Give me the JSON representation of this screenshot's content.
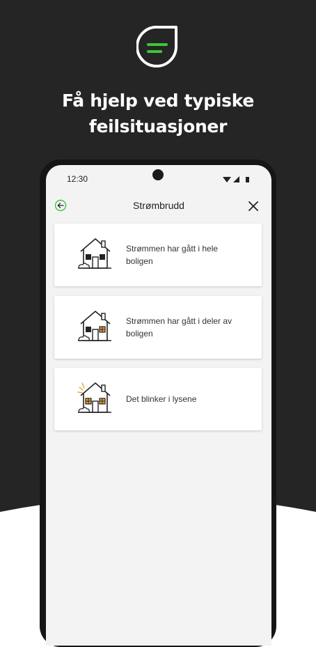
{
  "headline": {
    "line1": "Få hjelp ved typiske",
    "line2": "feilsituasjoner"
  },
  "colors": {
    "background_dark": "#252525",
    "accent_green": "#3ec639",
    "window_lit": "#e8a33d"
  },
  "status_bar": {
    "time": "12:30",
    "icons": [
      "wifi-icon",
      "signal-icon",
      "battery-icon"
    ]
  },
  "app_bar": {
    "title": "Strømbrudd",
    "back_icon": "back-arrow-icon",
    "close_icon": "close-icon"
  },
  "options": [
    {
      "label": "Strømmen har gått i hele boligen",
      "icon": "house-dark-icon"
    },
    {
      "label": "Strømmen har gått i deler av boligen",
      "icon": "house-partial-icon"
    },
    {
      "label": "Det blinker i lysene",
      "icon": "house-flicker-icon"
    }
  ]
}
